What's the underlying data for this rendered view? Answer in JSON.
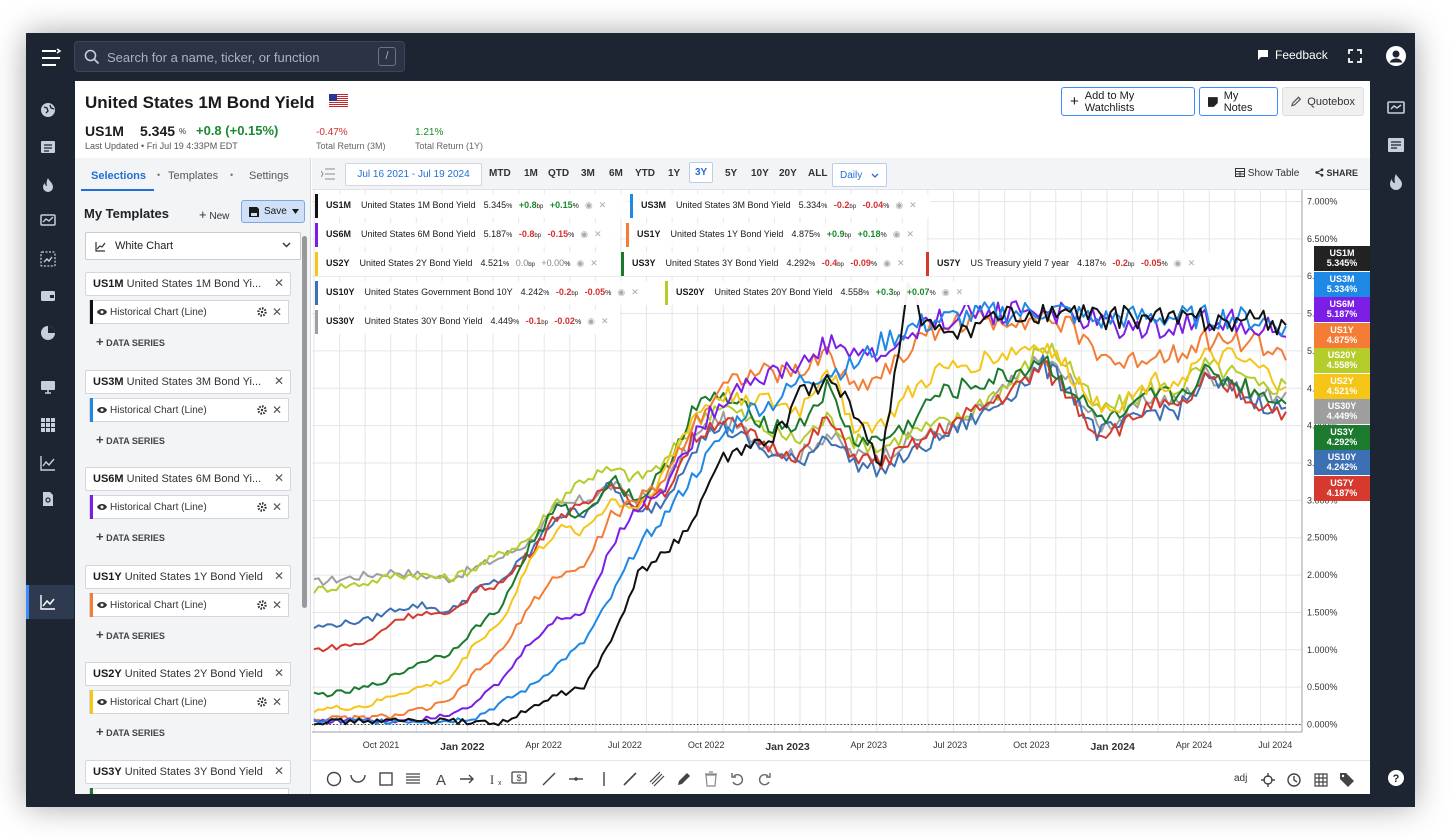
{
  "search": {
    "placeholder": "Search for a name, ticker, or function",
    "shortcut": "/"
  },
  "topbar": {
    "feedback_label": "Feedback"
  },
  "header": {
    "title": "United States 1M Bond Yield",
    "symbol": "US1M",
    "price": "5.345",
    "price_unit": "%",
    "change": "+0.8  (+0.15%)",
    "last_updated": "Last Updated • Fri Jul 19 4:33PM EDT",
    "return_3m_value": "-0.47%",
    "return_3m_label": "Total Return (3M)",
    "return_1y_value": "1.21%",
    "return_1y_label": "Total Return (1Y)",
    "add_watchlist_label": "Add to My Watchlists",
    "my_notes_label": "My Notes",
    "quotebox_label": "Quotebox"
  },
  "left_panel": {
    "tabs": [
      "Selections",
      "Templates",
      "Settings"
    ],
    "my_templates_label": "My Templates",
    "new_label": "New",
    "save_label": "Save",
    "template_select": "White Chart",
    "data_series_label": "DATA SERIES",
    "chart_type_label": "Historical Chart (Line)",
    "cards": [
      {
        "symbol": "US1M",
        "name": "United States 1M Bond Yi...",
        "color": "#111111"
      },
      {
        "symbol": "US3M",
        "name": "United States 3M Bond Yi...",
        "color": "#1e88e5"
      },
      {
        "symbol": "US6M",
        "name": "United States 6M Bond Yi...",
        "color": "#7b1fe6"
      },
      {
        "symbol": "US1Y",
        "name": "United States 1Y Bond Yield",
        "color": "#f57c35"
      },
      {
        "symbol": "US2Y",
        "name": "United States 2Y Bond Yield",
        "color": "#f5c518"
      },
      {
        "symbol": "US3Y",
        "name": "United States 3Y Bond Yield",
        "color": "#1b7a2e"
      }
    ]
  },
  "toolbar": {
    "date_range": "Jul 16 2021 - Jul 19 2024",
    "ranges": [
      "MTD",
      "1M",
      "QTD",
      "3M",
      "6M",
      "YTD",
      "1Y",
      "3Y",
      "5Y",
      "10Y",
      "20Y",
      "ALL"
    ],
    "active_range": "3Y",
    "interval": "Daily",
    "show_table_label": "Show Table",
    "share_label": "SHARE"
  },
  "legend": [
    {
      "sym": "US1M",
      "name": "United States 1M Bond Yield",
      "val": "5.345",
      "chg": "+0.8",
      "pct": "+0.15",
      "color": "#111111",
      "dir": "pos"
    },
    {
      "sym": "US3M",
      "name": "United States 3M Bond Yield",
      "val": "5.334",
      "chg": "-0.2",
      "pct": "-0.04",
      "color": "#1e88e5",
      "dir": "neg"
    },
    {
      "sym": "US6M",
      "name": "United States 6M Bond Yield",
      "val": "5.187",
      "chg": "-0.8",
      "pct": "-0.15",
      "color": "#7b1fe6",
      "dir": "neg"
    },
    {
      "sym": "US1Y",
      "name": "United States 1Y Bond Yield",
      "val": "4.875",
      "chg": "+0.9",
      "pct": "+0.18",
      "color": "#f57c35",
      "dir": "pos"
    },
    {
      "sym": "US2Y",
      "name": "United States 2Y Bond Yield",
      "val": "4.521",
      "chg": "0.0",
      "pct": "+0.00",
      "color": "#f5c518",
      "dir": "mut"
    },
    {
      "sym": "US3Y",
      "name": "United States 3Y Bond Yield",
      "val": "4.292",
      "chg": "-0.4",
      "pct": "-0.09",
      "color": "#1b7a2e",
      "dir": "neg"
    },
    {
      "sym": "US7Y",
      "name": "US Treasury yield 7 year",
      "val": "4.187",
      "chg": "-0.2",
      "pct": "-0.05",
      "color": "#d63a2f",
      "dir": "neg"
    },
    {
      "sym": "US10Y",
      "name": "United States Government Bond 10Y",
      "val": "4.242",
      "chg": "-0.2",
      "pct": "-0.05",
      "color": "#3d6fb5",
      "dir": "neg"
    },
    {
      "sym": "US20Y",
      "name": "United States 20Y Bond Yield",
      "val": "4.558",
      "chg": "+0.3",
      "pct": "+0.07",
      "color": "#b5cc2a",
      "dir": "pos"
    },
    {
      "sym": "US30Y",
      "name": "United States 30Y Bond Yield",
      "val": "4.449",
      "chg": "-0.1",
      "pct": "-0.02",
      "color": "#9e9e9e",
      "dir": "neg"
    }
  ],
  "legend_unit": "%",
  "legend_sub": "bp",
  "right_tags": [
    {
      "sym": "US1M",
      "val": "5.345%",
      "color": "#222222"
    },
    {
      "sym": "US3M",
      "val": "5.334%",
      "color": "#1e88e5"
    },
    {
      "sym": "US6M",
      "val": "5.187%",
      "color": "#7b1fe6"
    },
    {
      "sym": "US1Y",
      "val": "4.875%",
      "color": "#f57c35"
    },
    {
      "sym": "US20Y",
      "val": "4.558%",
      "color": "#b5cc2a"
    },
    {
      "sym": "US2Y",
      "val": "4.521%",
      "color": "#f5c518"
    },
    {
      "sym": "US30Y",
      "val": "4.449%",
      "color": "#9e9e9e"
    },
    {
      "sym": "US3Y",
      "val": "4.292%",
      "color": "#1b7a2e"
    },
    {
      "sym": "US10Y",
      "val": "4.242%",
      "color": "#3d6fb5"
    },
    {
      "sym": "US7Y",
      "val": "4.187%",
      "color": "#d63a2f"
    }
  ],
  "bottombar": {
    "adj_label": "adj"
  },
  "chart_data": {
    "type": "line",
    "title": "",
    "xlabel": "",
    "ylabel": "",
    "x_ticks": [
      "Oct 2021",
      "Jan 2022",
      "Apr 2022",
      "Jul 2022",
      "Oct 2022",
      "Jan 2023",
      "Apr 2023",
      "Jul 2023",
      "Oct 2023",
      "Jan 2024",
      "Apr 2024",
      "Jul 2024"
    ],
    "x_major": [
      "Jan 2022",
      "Jan 2023",
      "Jan 2024"
    ],
    "y_ticks": [
      "0.000%",
      "0.500%",
      "1.000%",
      "1.500%",
      "2.000%",
      "2.500%",
      "3.000%",
      "3.500%",
      "4.000%",
      "4.500%",
      "5.000%",
      "5.500%",
      "6.000%",
      "6.500%",
      "7.000%"
    ],
    "ylim": [
      -0.1,
      7.1
    ],
    "grid": true,
    "x": [
      "Jul 2021",
      "Aug 2021",
      "Sep 2021",
      "Oct 2021",
      "Nov 2021",
      "Dec 2021",
      "Jan 2022",
      "Feb 2022",
      "Mar 2022",
      "Apr 2022",
      "May 2022",
      "Jun 2022",
      "Jul 2022",
      "Aug 2022",
      "Sep 2022",
      "Oct 2022",
      "Nov 2022",
      "Dec 2022",
      "Jan 2023",
      "Feb 2023",
      "Mar 2023",
      "Apr 2023",
      "May 2023",
      "Jun 2023",
      "Jul 2023",
      "Aug 2023",
      "Sep 2023",
      "Oct 2023",
      "Nov 2023",
      "Dec 2023",
      "Jan 2024",
      "Feb 2024",
      "Mar 2024",
      "Apr 2024",
      "May 2024",
      "Jun 2024",
      "Jul 2024"
    ],
    "series": [
      {
        "name": "US1M",
        "color": "#111111",
        "values": [
          0.04,
          0.04,
          0.05,
          0.05,
          0.05,
          0.04,
          0.03,
          0.03,
          0.2,
          0.4,
          0.5,
          1.1,
          2.0,
          2.3,
          2.7,
          3.5,
          3.7,
          3.8,
          4.4,
          4.6,
          4.2,
          3.5,
          5.8,
          5.2,
          5.3,
          5.4,
          5.45,
          5.5,
          5.5,
          5.45,
          5.45,
          5.45,
          5.45,
          5.43,
          5.43,
          5.42,
          5.345
        ]
      },
      {
        "name": "US3M",
        "color": "#1e88e5",
        "values": [
          0.05,
          0.05,
          0.04,
          0.05,
          0.05,
          0.05,
          0.1,
          0.3,
          0.5,
          0.8,
          1.1,
          1.7,
          2.4,
          2.8,
          3.3,
          3.8,
          4.2,
          4.3,
          4.6,
          4.7,
          4.8,
          5.1,
          5.3,
          5.4,
          5.45,
          5.5,
          5.5,
          5.55,
          5.5,
          5.4,
          5.45,
          5.45,
          5.45,
          5.45,
          5.45,
          5.4,
          5.334
        ]
      },
      {
        "name": "US6M",
        "color": "#7b1fe6",
        "values": [
          0.05,
          0.05,
          0.05,
          0.06,
          0.08,
          0.15,
          0.3,
          0.6,
          1.1,
          1.4,
          1.5,
          2.4,
          2.9,
          3.2,
          3.8,
          4.3,
          4.6,
          4.7,
          4.8,
          5.1,
          5.0,
          4.9,
          5.2,
          5.4,
          5.5,
          5.5,
          5.55,
          5.55,
          5.45,
          5.4,
          5.3,
          5.3,
          5.35,
          5.4,
          5.4,
          5.35,
          5.187
        ]
      },
      {
        "name": "US1Y",
        "color": "#f57c35",
        "values": [
          0.07,
          0.08,
          0.09,
          0.12,
          0.2,
          0.3,
          0.7,
          1.0,
          1.6,
          2.0,
          2.1,
          2.8,
          3.0,
          3.3,
          4.0,
          4.5,
          4.7,
          4.7,
          4.7,
          5.0,
          4.5,
          4.7,
          5.0,
          5.3,
          5.4,
          5.4,
          5.45,
          5.45,
          5.3,
          5.0,
          4.8,
          4.95,
          5.0,
          5.15,
          5.15,
          5.1,
          4.875
        ]
      },
      {
        "name": "US2Y",
        "color": "#f5c518",
        "values": [
          0.2,
          0.22,
          0.25,
          0.4,
          0.5,
          0.6,
          1.1,
          1.4,
          2.2,
          2.6,
          2.6,
          3.0,
          2.9,
          3.4,
          4.1,
          4.4,
          4.4,
          4.3,
          4.2,
          4.8,
          4.0,
          4.0,
          4.4,
          4.7,
          4.8,
          4.9,
          5.0,
          5.1,
          4.7,
          4.3,
          4.3,
          4.6,
          4.6,
          4.9,
          4.9,
          4.75,
          4.521
        ]
      },
      {
        "name": "US3Y",
        "color": "#1b7a2e",
        "values": [
          0.4,
          0.42,
          0.5,
          0.65,
          0.85,
          0.95,
          1.3,
          1.6,
          2.4,
          2.9,
          2.8,
          3.3,
          3.0,
          3.4,
          4.2,
          4.4,
          4.2,
          4.0,
          4.0,
          4.5,
          3.8,
          3.8,
          4.0,
          4.4,
          4.5,
          4.6,
          4.7,
          4.9,
          4.5,
          4.1,
          4.1,
          4.4,
          4.4,
          4.7,
          4.6,
          4.45,
          4.292
        ]
      },
      {
        "name": "US7Y",
        "color": "#d63a2f",
        "values": [
          1.0,
          1.05,
          1.1,
          1.4,
          1.5,
          1.45,
          1.8,
          1.9,
          2.3,
          2.8,
          2.9,
          3.3,
          2.9,
          3.1,
          3.8,
          4.1,
          3.9,
          3.7,
          3.6,
          4.1,
          3.6,
          3.5,
          3.7,
          3.9,
          4.1,
          4.3,
          4.5,
          4.8,
          4.4,
          3.9,
          4.0,
          4.3,
          4.2,
          4.6,
          4.5,
          4.3,
          4.187
        ]
      },
      {
        "name": "US10Y",
        "color": "#3d6fb5",
        "values": [
          1.3,
          1.35,
          1.4,
          1.55,
          1.6,
          1.5,
          1.8,
          1.95,
          2.3,
          2.8,
          2.85,
          3.2,
          2.8,
          3.0,
          3.7,
          4.0,
          3.8,
          3.6,
          3.5,
          3.9,
          3.5,
          3.4,
          3.6,
          3.8,
          4.0,
          4.2,
          4.5,
          4.8,
          4.5,
          3.9,
          4.0,
          4.2,
          4.2,
          4.6,
          4.5,
          4.3,
          4.242
        ]
      },
      {
        "name": "US20Y",
        "color": "#b5cc2a",
        "values": [
          1.8,
          1.85,
          1.9,
          2.0,
          2.0,
          1.95,
          2.1,
          2.3,
          2.5,
          3.0,
          3.3,
          3.4,
          3.3,
          3.5,
          4.0,
          4.3,
          4.1,
          3.9,
          3.8,
          4.1,
          3.8,
          3.7,
          3.9,
          4.0,
          4.1,
          4.4,
          4.6,
          5.1,
          4.8,
          4.2,
          4.3,
          4.5,
          4.5,
          4.8,
          4.7,
          4.5,
          4.558
        ]
      },
      {
        "name": "US30Y",
        "color": "#9e9e9e",
        "values": [
          1.9,
          1.95,
          2.0,
          2.05,
          2.0,
          1.95,
          2.1,
          2.25,
          2.45,
          2.9,
          3.0,
          3.2,
          3.0,
          3.2,
          3.8,
          4.1,
          3.9,
          3.7,
          3.6,
          3.9,
          3.6,
          3.6,
          3.8,
          3.9,
          4.0,
          4.3,
          4.6,
          4.9,
          4.6,
          4.0,
          4.1,
          4.4,
          4.3,
          4.7,
          4.6,
          4.4,
          4.449
        ]
      }
    ]
  }
}
